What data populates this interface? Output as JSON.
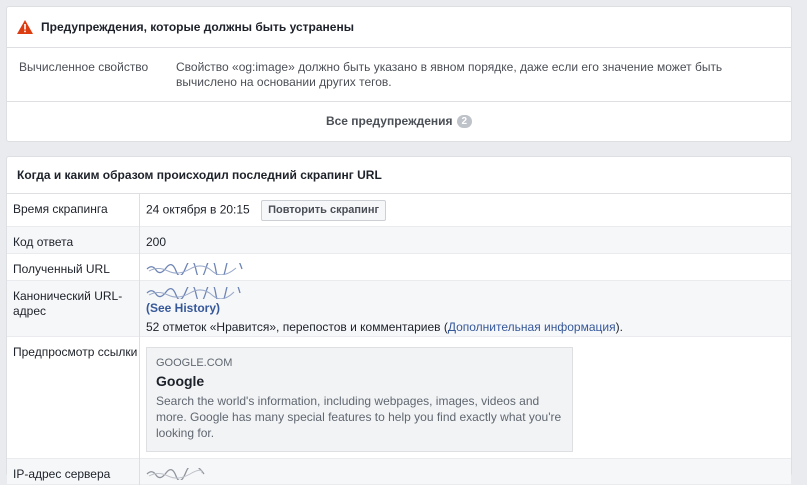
{
  "warnings": {
    "title": "Предупреждения, которые должны быть устранены",
    "icon": "warning-icon",
    "rows": [
      {
        "label": "Вычисленное свойство",
        "text": "Свойство «og:image» должно быть указано в явном порядке, даже если его значение может быть вычислено на основании других тегов."
      }
    ],
    "see_all_label": "Все предупреждения",
    "count": "2"
  },
  "scrape": {
    "title": "Когда и каким образом происходил последний скрапинг URL",
    "rows": {
      "time": {
        "label": "Время скрапинга",
        "value": "24 октября в 20:15",
        "button": "Повторить скрапинг"
      },
      "code": {
        "label": "Код ответа",
        "value": "200"
      },
      "fetched_url": {
        "label": "Полученный URL"
      },
      "canonical": {
        "label": "Канонический URL-адрес",
        "history_link": "(See History)",
        "likes_text": "52 отметок «Нравится», перепостов и комментариев (",
        "more_info_link": "Дополнительная информация",
        "likes_tail": ")."
      },
      "preview": {
        "label": "Предпросмотр ссылки",
        "domain": "GOOGLE.COM",
        "title": "Google",
        "description": "Search the world's information, including webpages, images, videos and more. Google has many special features to help you find exactly what you're looking for."
      },
      "ip": {
        "label": "IP-адрес сервера"
      }
    }
  },
  "colors": {
    "link": "#365899",
    "warning": "#dd3c10",
    "background": "#e9ebee"
  }
}
